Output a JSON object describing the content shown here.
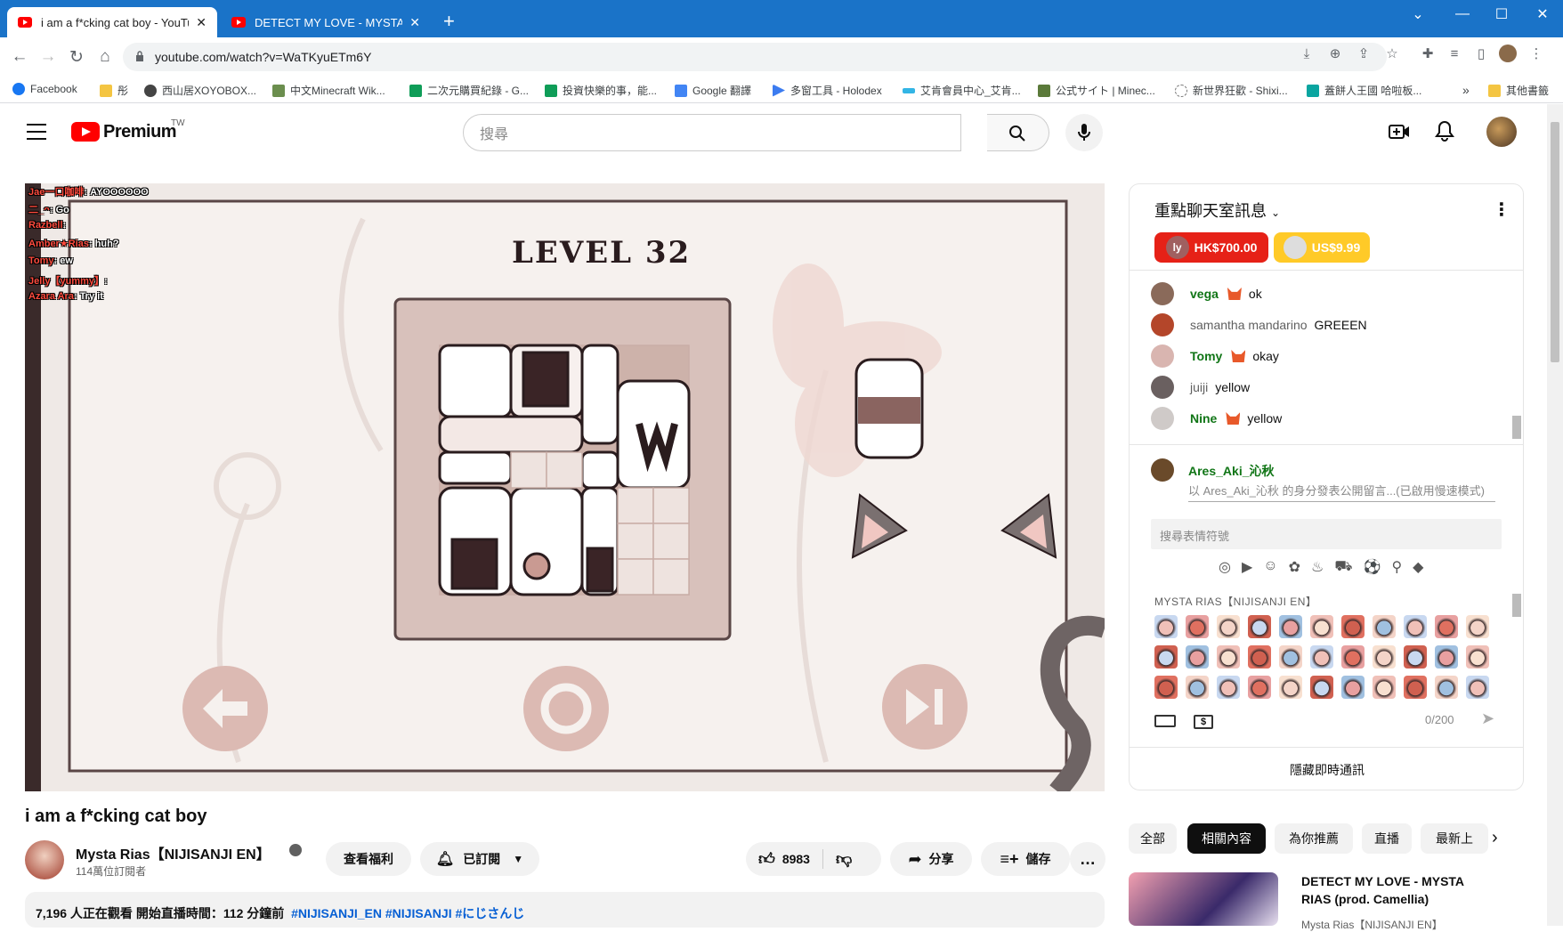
{
  "browser": {
    "tabs": [
      {
        "title": "i am a f*cking cat boy - YouTub",
        "active": true
      },
      {
        "title": "DETECT MY LOVE - MYSTA RIAS",
        "active": false
      }
    ],
    "new_tab": "+",
    "url": "youtube.com/watch?v=WaTKyuETm6Y",
    "bookmarks": [
      "Facebook",
      "彤",
      "西山居XOYOBOX...",
      "中文Minecraft Wik...",
      "二次元購買紀錄 - G...",
      "投資快樂的事，能...",
      "Google 翻譯",
      "多窗工具 - Holodex",
      "艾肯會員中心_艾肯...",
      "公式サイト | Minec...",
      "新世界狂歡 - Shixi...",
      "蓋餅人王國 哈啦板..."
    ],
    "bookmarks_more": "»",
    "other_bookmarks": "其他書籤"
  },
  "youtube": {
    "logo": "Premium",
    "region": "TW",
    "search_placeholder": "搜尋"
  },
  "video": {
    "level_text": "LEVEL 32",
    "overlay_chat": [
      {
        "name": "Jae一口咖啡",
        "text": "AYOOOOOO"
      },
      {
        "name": "二_ᴖ",
        "text": "Go"
      },
      {
        "name": "Razbell",
        "text": ""
      },
      {
        "name": "Amber★Rias",
        "text": "huh?"
      },
      {
        "name": "Tomy",
        "text": "ew"
      },
      {
        "name": "Jelly【yummy】",
        "text": ""
      },
      {
        "name": "Azara Ara",
        "text": "Try it"
      }
    ],
    "title": "i am a f*cking cat boy",
    "channel": "Mysta Rias【NIJISANJI EN】",
    "subscribers": "114萬位訂閱者",
    "perks_label": "查看福利",
    "subscribed_label": "已訂閱",
    "likes": "8983",
    "share_label": "分享",
    "save_label": "儲存",
    "more_label": "…",
    "desc_stats": "7,196 人正在觀看  開始直播時間：112 分鐘前",
    "desc_tags": "#NIJISANJI_EN #NIJISANJI #にじさんじ"
  },
  "chat": {
    "header": "重點聊天室訊息",
    "superchats": [
      {
        "avatar": "ly",
        "amount": "HK$700.00",
        "color": "#e62117"
      },
      {
        "avatar": "",
        "amount": "US$9.99",
        "color": "#ffca28"
      }
    ],
    "messages": [
      {
        "name": "vega",
        "text": "ok",
        "member": true
      },
      {
        "name": "samantha mandarino",
        "text": "GREEEN",
        "member": false
      },
      {
        "name": "Tomy",
        "text": "okay",
        "member": true
      },
      {
        "name": "juiji",
        "text": "yellow",
        "member": false
      },
      {
        "name": "Nine",
        "text": "yellow",
        "member": true
      }
    ],
    "composer_name": "Ares_Aki_沁秋",
    "composer_hint": "以 Ares_Aki_沁秋 的身分發表公開留言...(已啟用慢速模式)",
    "emoji_search": "搜尋表情符號",
    "emoji_section": "MYSTA RIAS【NIJISANJI EN】",
    "char_count": "0/200",
    "hide_chat": "隱藏即時通訊"
  },
  "related": {
    "chips": [
      "全部",
      "相關內容",
      "為你推薦",
      "直播",
      "最新上"
    ],
    "first_title": "DETECT MY LOVE - MYSTA RIAS (prod. Camellia)",
    "first_channel": "Mysta Rias【NIJISANJI EN】"
  }
}
